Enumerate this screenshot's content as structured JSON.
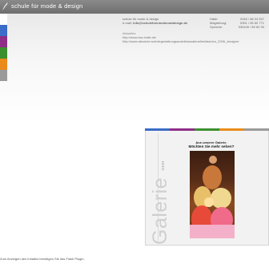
{
  "header": {
    "brand": "schule für mode & design",
    "logo": "leaf-logo-icon",
    "bar_color": "#7c7c7c"
  },
  "nav_tabs": [
    {
      "name": "white-tab",
      "color": "#ffffff"
    },
    {
      "name": "blue-tab",
      "color": "#3b6cc7"
    },
    {
      "name": "purple-tab",
      "color": "#8e2e86"
    },
    {
      "name": "green-tab",
      "color": "#3c8f2e"
    },
    {
      "name": "orange-tab",
      "color": "#e98a1a"
    },
    {
      "name": "gray-tab",
      "color": "#9a9a9a"
    }
  ],
  "contact": {
    "school": "schule für mode & design",
    "email_label": "e-mail:",
    "email": "info@schulefuermodeunddesign.de",
    "rows": [
      {
        "label": "Halle:",
        "value": "0345 / 68 04 537"
      },
      {
        "label": "Magdeburg:",
        "value": "0391 / 55 60 771"
      },
      {
        "label": "Sprüche:",
        "value": "030449 / 80 60 30"
      }
    ]
  },
  "links": {
    "label": "Aktuelles:",
    "items": [
      "http://www.bsz-halle.de/",
      "http://www.absolute-schulegestaltungsausbildunsaktuelles/fashion_2006_designer"
    ]
  },
  "galerie": {
    "title": "Galerie",
    "promo_line1": "Aus unserer Galerie.",
    "promo_line2": "Möchten Sie mehr sehen?",
    "stripe_colors": [
      "#3b6cc7",
      "#8e2e86",
      "#3c8f2e",
      "#e98a1a",
      "#9a9a9a"
    ]
  },
  "footer": {
    "flash_notice": "Zum Anzeigen des Inhaltes benötigen Sie das Flash Plugin."
  }
}
